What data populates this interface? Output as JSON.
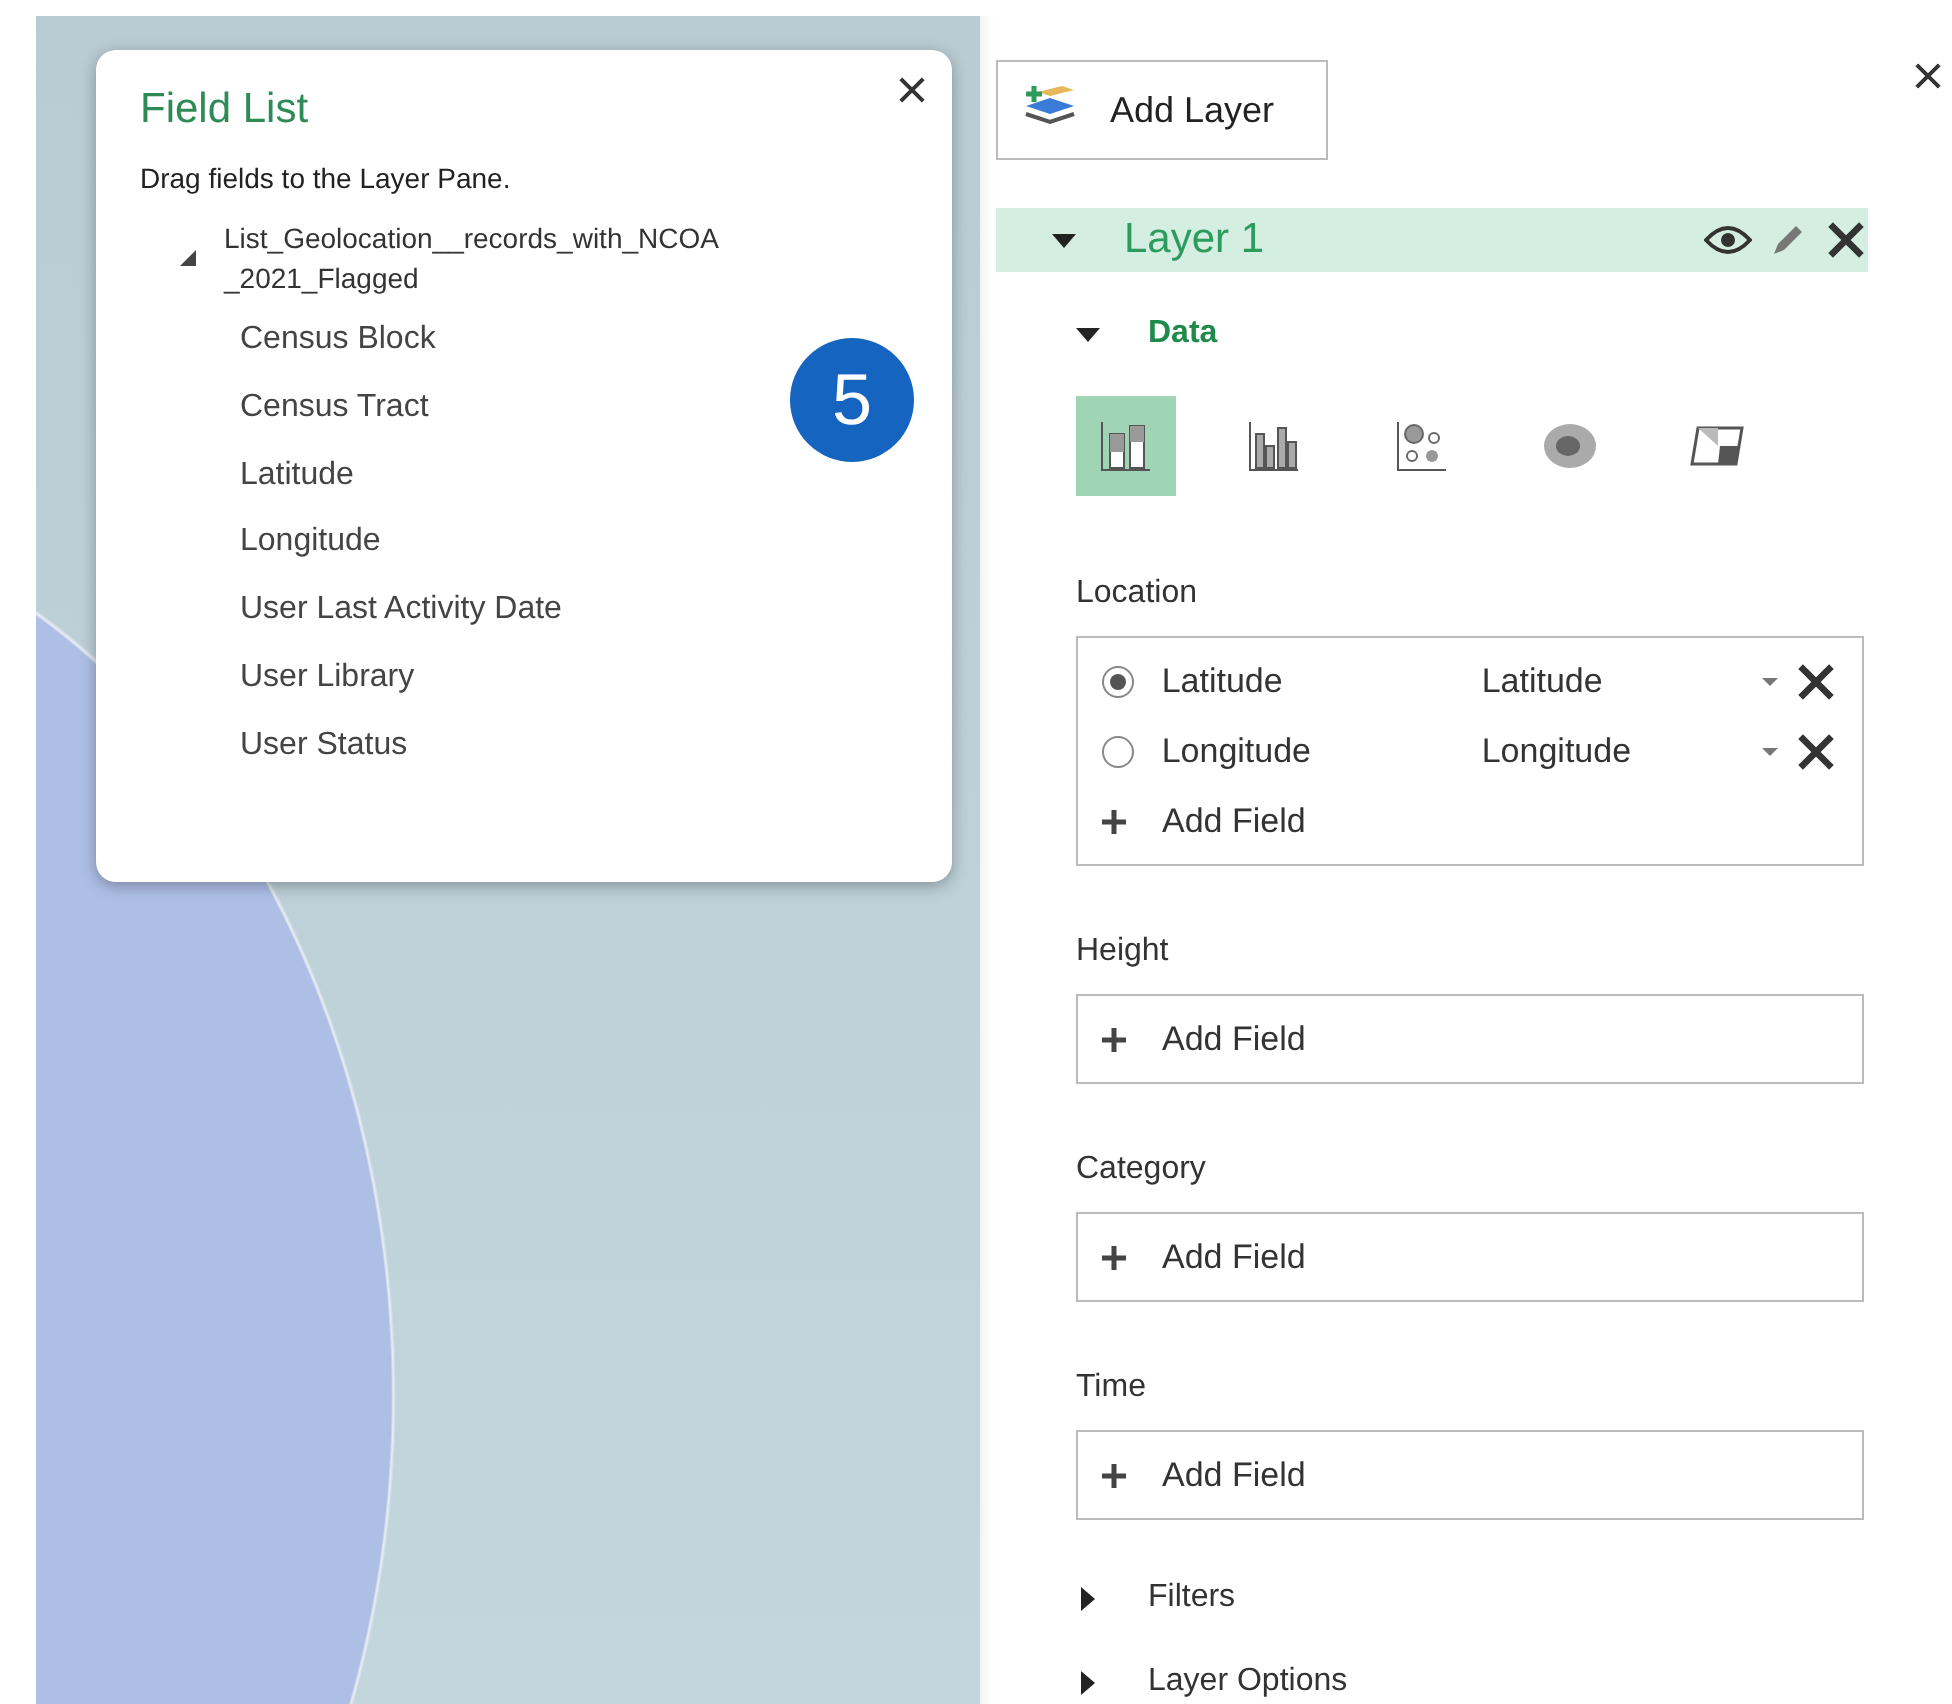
{
  "field_list": {
    "title": "Field List",
    "hint": "Drag fields to the Layer Pane.",
    "table": {
      "name": "List_Geolocation__records_with_NCOA _2021_Flagged",
      "expanded": true,
      "fields": [
        "Census Block",
        "Census Tract",
        "Latitude",
        "Longitude",
        "User Last Activity Date",
        "User Library",
        "User Status"
      ]
    }
  },
  "step_badge": "5",
  "layer_pane": {
    "add_layer": "Add Layer",
    "layer": {
      "name": "Layer 1",
      "expanded": true
    },
    "data_section": {
      "title": "Data",
      "expanded": true
    },
    "viz_types": [
      {
        "kind": "stacked",
        "selected": true
      },
      {
        "kind": "clustered",
        "selected": false
      },
      {
        "kind": "bubble",
        "selected": false
      },
      {
        "kind": "heatmap",
        "selected": false
      },
      {
        "kind": "region",
        "selected": false
      }
    ],
    "location": {
      "label": "Location",
      "fields": [
        {
          "name": "Latitude",
          "type": "Latitude",
          "selected": true
        },
        {
          "name": "Longitude",
          "type": "Longitude",
          "selected": false
        }
      ],
      "add": "Add Field"
    },
    "wells": [
      {
        "label": "Height",
        "add": "Add Field"
      },
      {
        "label": "Category",
        "add": "Add Field"
      },
      {
        "label": "Time",
        "add": "Add Field"
      }
    ],
    "collapsed_sections": [
      {
        "title": "Filters",
        "expanded": false
      },
      {
        "title": "Layer Options",
        "expanded": false
      }
    ]
  }
}
